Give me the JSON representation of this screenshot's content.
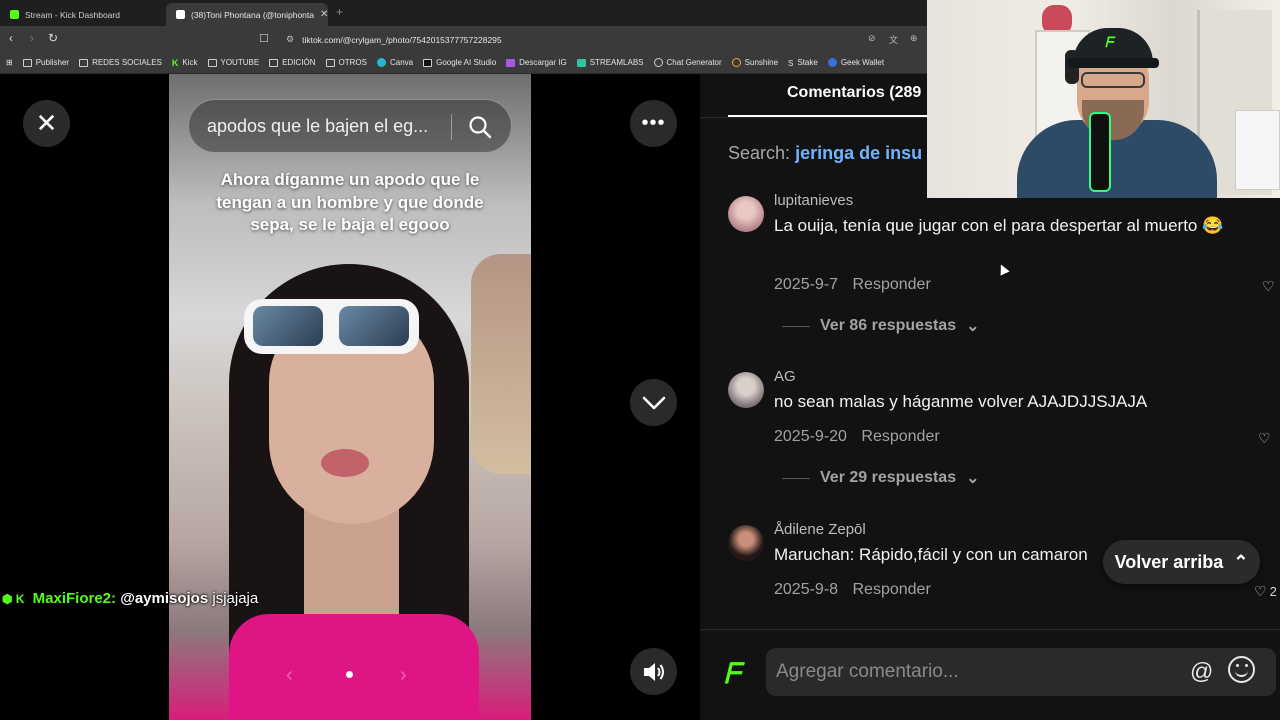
{
  "browser": {
    "tabs": [
      {
        "label": "Stream - Kick Dashboard",
        "favicon_color": "#53fc18"
      },
      {
        "label": "(38)Toni Phontana (@toniphonta",
        "favicon_color": "#ffffff"
      }
    ],
    "new_tab": "+",
    "url": "tiktok.com/@crylgam_/photo/7542015377757228295",
    "bookmarks": [
      {
        "label": "Publisher",
        "icon": "folder-icon"
      },
      {
        "label": "REDES SOCIALES",
        "icon": "folder-icon"
      },
      {
        "label": "Kick",
        "icon": "kick-icon"
      },
      {
        "label": "YOUTUBE",
        "icon": "folder-icon"
      },
      {
        "label": "EDICIÓN",
        "icon": "folder-icon"
      },
      {
        "label": "OTROS",
        "icon": "folder-icon"
      },
      {
        "label": "Canva",
        "icon": "canva-icon"
      },
      {
        "label": "Google AI Studio",
        "icon": "ai-studio-icon"
      },
      {
        "label": "Descargar IG",
        "icon": "download-icon"
      },
      {
        "label": "STREAMLABS",
        "icon": "streamlabs-icon"
      },
      {
        "label": "Chat Generator",
        "icon": "chat-icon"
      },
      {
        "label": "Sunshine",
        "icon": "sun-icon"
      },
      {
        "label": "Stake",
        "icon": "stake-icon"
      },
      {
        "label": "Geek Wallet",
        "icon": "wallet-icon"
      }
    ]
  },
  "viewer": {
    "search_query": "apodos que le bajen el eg...",
    "overlay_text": "Ahora díganme un apodo que le tengan a un hombre y que donde sepa, se le baja el egooo",
    "close_symbol": "✕",
    "more_symbol": "•••",
    "prev_symbol": "‹",
    "next_symbol": "›"
  },
  "stream_chat": {
    "user": "MaxiFiore2:",
    "mention": "@aymisojos",
    "message": "jsjajaja"
  },
  "comments": {
    "tab_label": "Comentarios (289",
    "search_prefix": "Search:",
    "search_term": "jeringa de insu",
    "items": [
      {
        "user": "lupitanieves",
        "text": "La ouija, tenía que jugar con el para despertar al muerto 😂",
        "date": "2025-9-7",
        "reply": "Responder",
        "replies": "Ver 86 respuestas"
      },
      {
        "user": "AG",
        "text": "no sean malas y háganme volver AJAJDJJSJAJA",
        "date": "2025-9-20",
        "reply": "Responder",
        "replies": "Ver 29 respuestas"
      },
      {
        "user": "Ådilene Zepōl",
        "text": "Maruchan: Rápido,fácil y con un camaron",
        "date": "2025-9-8",
        "reply": "Responder",
        "likes": "2"
      }
    ],
    "back_to_top": "Volver arriba",
    "input_placeholder": "Agregar comentario...",
    "at_symbol": "@"
  },
  "colors": {
    "kick_green": "#53fc18",
    "search_term": "#6fb3ff"
  }
}
